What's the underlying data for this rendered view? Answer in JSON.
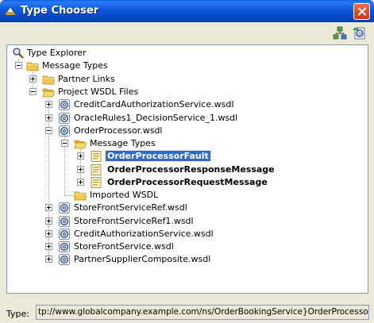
{
  "window": {
    "title": "Type Chooser",
    "colors": {
      "titlebar": "#0a56d8",
      "selection": "#316ac5",
      "folder": "#f4c84a"
    }
  },
  "toolbar": {
    "buttons": [
      "tree-view-icon",
      "wsdl-import-icon"
    ]
  },
  "tree": {
    "root": "Type Explorer",
    "message_types": "Message Types",
    "partner_links": "Partner Links",
    "project_wsdl_files": "Project WSDL Files",
    "wsdl_files": [
      "CreditCardAuthorizationService.wsdl",
      "OracleRules1_DecisionService_1.wsdl",
      "OrderProcessor.wsdl"
    ],
    "op_message_types": "Message Types",
    "messages": [
      "OrderProcessorFault",
      "OrderProcessorResponseMessage",
      "OrderProcessorRequestMessage"
    ],
    "imported_wsdl": "Imported WSDL",
    "more_wsdl_files": [
      "StoreFrontServiceRef.wsdl",
      "StoreFrontServiceRef1.wsdl",
      "CreditAuthorizationService.wsdl",
      "StoreFrontService.wsdl",
      "PartnerSupplierComposite.wsdl"
    ],
    "selected": "OrderProcessorFault"
  },
  "type_field": {
    "label": "Type:",
    "value": "tp://www.globalcompany.example.com/ns/OrderBookingService}OrderProcessorFault"
  }
}
